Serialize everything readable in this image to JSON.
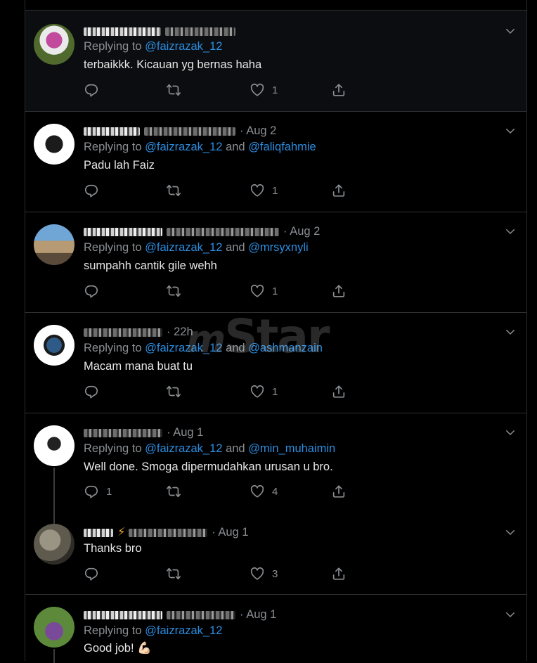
{
  "watermark": {
    "prefix": "m",
    "word": "Star"
  },
  "tweets": [
    {
      "time": "",
      "reply_prefix": "Replying to",
      "mention_1": "@faizrazak_12",
      "joiner": "",
      "mention_2": "",
      "text": "terbaikkk. Kicauan yg bernas haha",
      "replies": "",
      "likes": "1"
    },
    {
      "time": "Aug 2",
      "reply_prefix": "Replying to",
      "mention_1": "@faizrazak_12",
      "joiner": "and",
      "mention_2": "@faliqfahmie",
      "text": "Padu lah Faiz",
      "replies": "",
      "likes": "1"
    },
    {
      "time": "Aug 2",
      "reply_prefix": "Replying to",
      "mention_1": "@faizrazak_12",
      "joiner": "and",
      "mention_2": "@mrsyxnyli",
      "text": "sumpahh cantik gile wehh",
      "replies": "",
      "likes": "1"
    },
    {
      "time": "22h",
      "reply_prefix": "Replying to",
      "mention_1": "@faizrazak_12",
      "joiner": "and",
      "mention_2": "@ashmanzain",
      "text": "Macam mana buat tu",
      "replies": "",
      "likes": "1"
    },
    {
      "time": "Aug 1",
      "reply_prefix": "Replying to",
      "mention_1": "@faizrazak_12",
      "joiner": "and",
      "mention_2": "@min_muhaimin",
      "text": "Well done. Smoga dipermudahkan urusan u bro.",
      "replies": "1",
      "likes": "4"
    },
    {
      "time": "Aug 1",
      "reply_prefix": "",
      "mention_1": "",
      "joiner": "",
      "mention_2": "",
      "text": "Thanks bro",
      "replies": "",
      "likes": "3"
    },
    {
      "time": "Aug 1",
      "reply_prefix": "Replying to",
      "mention_1": "@faizrazak_12",
      "joiner": "",
      "mention_2": "",
      "text": "Good job! 💪🏻",
      "replies": "",
      "likes": ""
    }
  ],
  "separator": "·",
  "colors": {
    "background": "#000000",
    "mention": "#2b8de0",
    "muted": "#8b8f93",
    "divider": "#2f2f2f"
  },
  "icons": [
    "reply-icon",
    "retweet-icon",
    "like-icon",
    "share-icon",
    "chevron-down-icon"
  ]
}
